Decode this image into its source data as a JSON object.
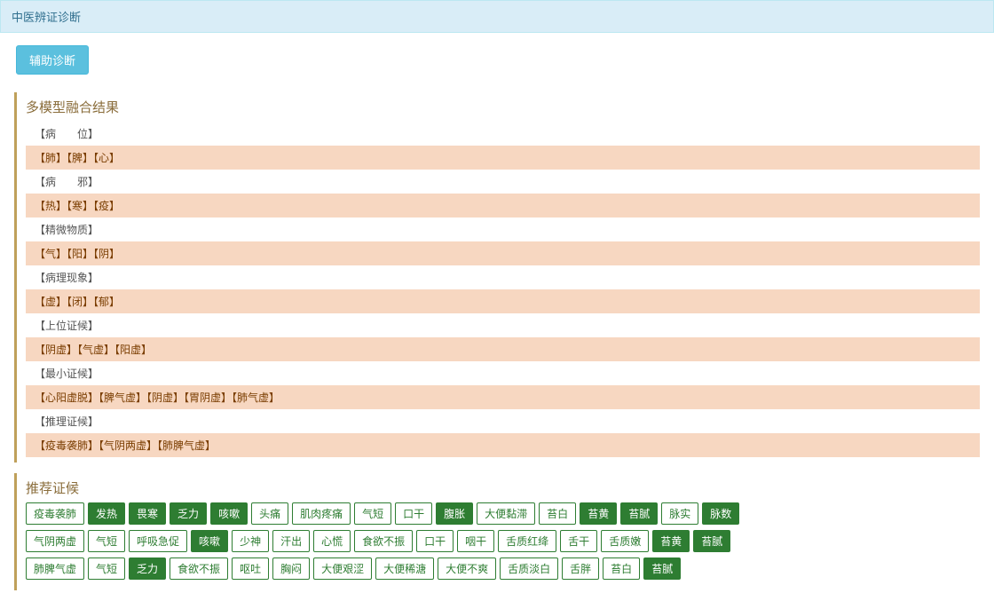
{
  "header": {
    "title": "中医辨证诊断"
  },
  "toolbar": {
    "assist_btn": "辅助诊断"
  },
  "fusion": {
    "title": "多模型融合结果",
    "rows": [
      {
        "text": "【病　　位】",
        "hl": false
      },
      {
        "text": "【肺】【脾】【心】",
        "hl": true
      },
      {
        "text": "【病　　邪】",
        "hl": false
      },
      {
        "text": "【热】【寒】【疫】",
        "hl": true
      },
      {
        "text": "【精微物质】",
        "hl": false
      },
      {
        "text": "【气】【阳】【阴】",
        "hl": true
      },
      {
        "text": "【病理现象】",
        "hl": false
      },
      {
        "text": "【虚】【闭】【郁】",
        "hl": true
      },
      {
        "text": "【上位证候】",
        "hl": false
      },
      {
        "text": "【阴虚】【气虚】【阳虚】",
        "hl": true
      },
      {
        "text": "【最小证候】",
        "hl": false
      },
      {
        "text": "【心阳虚脱】【脾气虚】【阴虚】【胃阴虚】【肺气虚】",
        "hl": true
      },
      {
        "text": "【推理证候】",
        "hl": false
      },
      {
        "text": "【疫毒袭肺】【气阴两虚】【肺脾气虚】",
        "hl": true
      }
    ]
  },
  "recommend": {
    "title": "推荐证候",
    "groups": [
      {
        "label": "疫毒袭肺",
        "tags": [
          {
            "t": "发热",
            "s": true
          },
          {
            "t": "畏寒",
            "s": true
          },
          {
            "t": "乏力",
            "s": true
          },
          {
            "t": "咳嗽",
            "s": true
          },
          {
            "t": "头痛",
            "s": false
          },
          {
            "t": "肌肉疼痛",
            "s": false
          },
          {
            "t": "气短",
            "s": false
          },
          {
            "t": "口干",
            "s": false
          },
          {
            "t": "腹胀",
            "s": true
          },
          {
            "t": "大便黏滞",
            "s": false
          },
          {
            "t": "苔白",
            "s": false
          },
          {
            "t": "苔黄",
            "s": true
          },
          {
            "t": "苔腻",
            "s": true
          },
          {
            "t": "脉实",
            "s": false
          },
          {
            "t": "脉数",
            "s": true
          }
        ]
      },
      {
        "label": "气阴两虚",
        "tags": [
          {
            "t": "气短",
            "s": false
          },
          {
            "t": "呼吸急促",
            "s": false
          },
          {
            "t": "咳嗽",
            "s": true
          },
          {
            "t": "少神",
            "s": false
          },
          {
            "t": "汗出",
            "s": false
          },
          {
            "t": "心慌",
            "s": false
          },
          {
            "t": "食欲不振",
            "s": false
          },
          {
            "t": "口干",
            "s": false
          },
          {
            "t": "咽干",
            "s": false
          },
          {
            "t": "舌质红绛",
            "s": false
          },
          {
            "t": "舌干",
            "s": false
          },
          {
            "t": "舌质嫩",
            "s": false
          },
          {
            "t": "苔黄",
            "s": true
          },
          {
            "t": "苔腻",
            "s": true
          }
        ]
      },
      {
        "label": "肺脾气虚",
        "tags": [
          {
            "t": "气短",
            "s": false
          },
          {
            "t": "乏力",
            "s": true
          },
          {
            "t": "食欲不振",
            "s": false
          },
          {
            "t": "呕吐",
            "s": false
          },
          {
            "t": "胸闷",
            "s": false
          },
          {
            "t": "大便艰涩",
            "s": false
          },
          {
            "t": "大便稀溏",
            "s": false
          },
          {
            "t": "大便不爽",
            "s": false
          },
          {
            "t": "舌质淡白",
            "s": false
          },
          {
            "t": "舌胖",
            "s": false
          },
          {
            "t": "苔白",
            "s": false
          },
          {
            "t": "苔腻",
            "s": true
          }
        ]
      }
    ]
  }
}
